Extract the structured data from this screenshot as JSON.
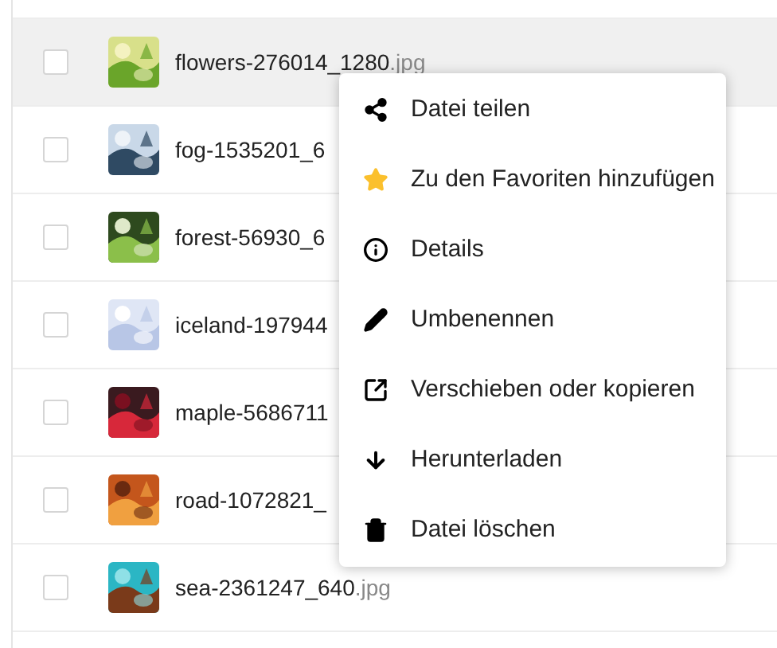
{
  "files": [
    {
      "name": "flowers-276014_1280",
      "extension": ".jpg",
      "highlighted": true,
      "checked": false
    },
    {
      "name": "fog-1535201_6",
      "highlighted": false,
      "checked": false
    },
    {
      "name": "forest-56930_6",
      "highlighted": false,
      "checked": false
    },
    {
      "name": "iceland-197944",
      "highlighted": false,
      "checked": false
    },
    {
      "name": "maple-5686711",
      "highlighted": false,
      "checked": false
    },
    {
      "name": "road-1072821_",
      "highlighted": false,
      "checked": false
    },
    {
      "name": "sea-2361247_640",
      "extension": ".jpg",
      "highlighted": false,
      "checked": false
    }
  ],
  "context_menu": [
    {
      "kind": "share",
      "label": "Datei teilen"
    },
    {
      "kind": "favorite",
      "label": "Zu den Favoriten hinzufügen"
    },
    {
      "kind": "details",
      "label": "Details"
    },
    {
      "kind": "rename",
      "label": "Umbenennen"
    },
    {
      "kind": "move",
      "label": "Verschieben oder kopieren"
    },
    {
      "kind": "download",
      "label": "Herunterladen"
    },
    {
      "kind": "delete",
      "label": "Datei löschen"
    }
  ]
}
